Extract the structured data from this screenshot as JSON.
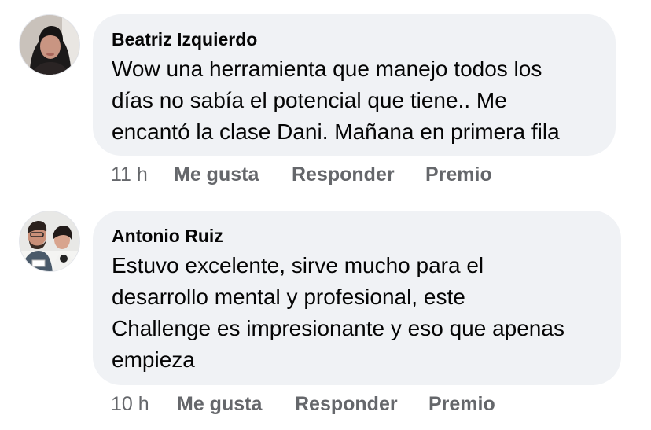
{
  "comments": [
    {
      "author": "Beatriz Izquierdo",
      "text": "Wow una herramienta que manejo todos los\ndías no sabía el potencial que tiene.. Me\nencantó la clase Dani. Mañana en primera fila",
      "time": "11 h",
      "like_label": "Me gusta",
      "reply_label": "Responder",
      "award_label": "Premio"
    },
    {
      "author": "Antonio Ruiz",
      "text": "Estuvo excelente, sirve mucho para el\ndesarrollo mental y profesional, este\nChallenge es impresionante y eso que apenas\nempieza",
      "time": "10 h",
      "like_label": "Me gusta",
      "reply_label": "Responder",
      "award_label": "Premio"
    }
  ]
}
